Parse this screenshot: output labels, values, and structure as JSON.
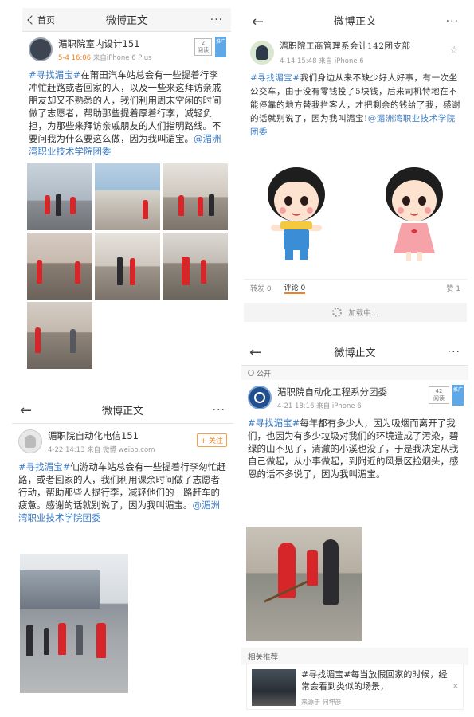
{
  "panel1": {
    "nav": {
      "back_label": "首页",
      "title": "微博正文",
      "more": "···"
    },
    "author": "湄职院室内设计151",
    "time": "5-4 16:06",
    "source": "来自iPhone 6 Plus",
    "reads": "2",
    "reads_label": "阅读",
    "ribbon": "推广",
    "tag": "#寻找湄宝#",
    "body": "在莆田汽车站总会有一些提着行李冲忙赶路或者回家的人，以及一些来这拜访亲戚朋友却又不熟悉的人，我们利用周末空闲的时间做了志愿者，帮助那些提着厚着行李，减轻负担，为那些来拜访亲戚朋友的人们指明路线。不要问我为什么要这么做，因为我叫湄宝。",
    "mention": "@湄洲湾职业技术学院团委"
  },
  "panel2": {
    "nav": {
      "back": "←",
      "title": "微博正文",
      "more": "···"
    },
    "author": "湄职院工商管理系会计142团支部",
    "time": "4-14 15:48",
    "source": "来自 iPhone 6",
    "tag": "#寻找湄宝#",
    "body": "我们身边从来不缺少好人好事，有一次坐公交车，由于没有零钱投了5块钱，后来司机特地在不能停靠的地方替我拦客人，才把剩余的钱给了我，感谢的话就别说了，因为我叫湄宝!",
    "mention": "@湄洲湾职业技术学院团委",
    "repost": "转发 0",
    "comment": "评论 0",
    "like": "赞 1",
    "loading": "加载中..."
  },
  "panel3": {
    "nav": {
      "back": "←",
      "title": "微博正文",
      "more": "···"
    },
    "author": "湄职院自动化电信151",
    "follow": "+ 关注",
    "time": "4-22 14:13",
    "source": "来自 微博 weibo.com",
    "tag": "#寻找湄宝#",
    "body": "仙游动车站总会有一些提着行李匆忙赶路，或者回家的人，我们利用课余时间做了志愿者行动，帮助那些人提行李，减轻他们的一路赶车的疲惫。感谢的话就别说了，因为我叫湄宝。",
    "mention": "@湄洲湾职业技术学院团委"
  },
  "panel4": {
    "nav": {
      "back": "←",
      "title": "微博止文",
      "more": "···"
    },
    "public": "公开",
    "author": "湄职院自动化工程系分团委",
    "time": "4-21 18:16",
    "source": "来自 iPhone 6",
    "reads": "42",
    "reads_label": "阅读",
    "ribbon": "推广",
    "tag": "#寻找湄宝#",
    "body": "每年都有多少人，因为吸烟而离开了我们，也因为有多少垃圾对我们的环境造成了污染，碧绿的山不见了，清澈的小溪也没了，于是我决定从我自己做起，从小事做起，到附近的风景区捡烟头，感恩的话不多说了，因为我叫湄宝。",
    "related_title": "相关推荐",
    "related_text": "#寻找湄宝#每当放假回家的时候，经常会看到类似的场景，",
    "related_source": "来源于 何坤彦",
    "related_close": "×"
  },
  "colors": {
    "link": "#3b7cc6",
    "time": "#f08020",
    "vest": "#d7262a"
  }
}
